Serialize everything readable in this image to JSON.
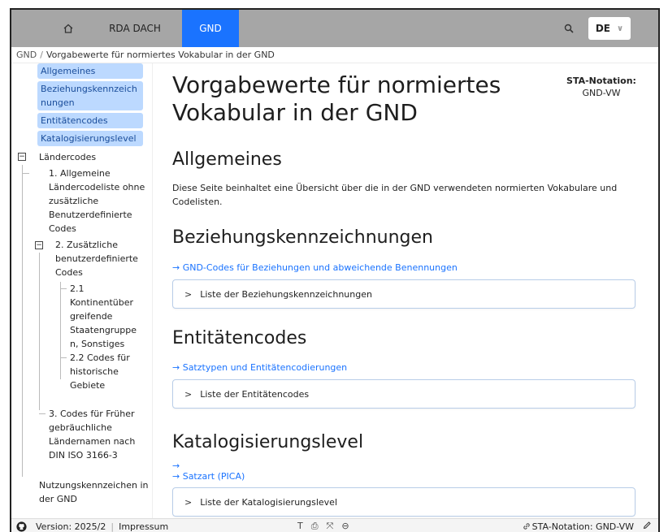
{
  "nav": {
    "home_icon": "home-icon",
    "items": [
      {
        "label": "RDA DACH"
      },
      {
        "label": "GND"
      }
    ],
    "search_icon": "search-icon",
    "language": "DE",
    "accent_color": "#1a73ff"
  },
  "breadcrumb": {
    "root": "GND",
    "separator": "/",
    "current": "Vorgabewerte für normiertes Vokabular in der GND"
  },
  "sidebar": {
    "highlighted": [
      {
        "label": "Allgemeines"
      },
      {
        "label": "Beziehungskennzeich nungen"
      },
      {
        "label": "Entitätencodes"
      },
      {
        "label": "Katalogisierungslevel"
      }
    ],
    "laendercodes": {
      "toggle": "−",
      "label": "Ländercodes",
      "children": [
        {
          "label": "1. Allgemeine Ländercodeliste ohne zusätzliche Benutzerdefinierte Codes"
        },
        {
          "toggle": "−",
          "label": "2. Zusätzliche benutzerdefinierte Codes",
          "children": [
            {
              "label": "2.1 Kontinentüber greifende Staatengruppe n, Sonstiges"
            },
            {
              "label": "2.2 Codes für historische Gebiete"
            }
          ]
        },
        {
          "label": "3. Codes für Früher gebräuchliche Ländernamen nach DIN ISO 3166-3"
        }
      ]
    },
    "nutzung": {
      "label": "Nutzungskennzeichen in der GND"
    }
  },
  "main": {
    "title": "Vorgabewerte für normiertes Vokabular in der GND",
    "sta_label": "STA-Notation:",
    "sta_value": "GND-VW",
    "sections": {
      "allgemeines": {
        "heading": "Allgemeines",
        "text": "Diese Seite beinhaltet eine Übersicht über die in der GND verwendeten normierten Vokabulare und Codelisten."
      },
      "beziehung": {
        "heading": "Beziehungskennzeichnungen",
        "link": "→ GND-Codes für Beziehungen und abweichende Benennungen",
        "details": "Liste der Beziehungskennzeichnungen"
      },
      "entitaet": {
        "heading": "Entitätencodes",
        "link": "→ Satztypen und Entitätencodierungen",
        "details": "Liste der Entitätencodes"
      },
      "katalog": {
        "heading": "Katalogisierungslevel",
        "link_arrow": "→",
        "link": "→ Satzart (PICA)",
        "details": "Liste der Katalogisierungslevel"
      }
    },
    "details_arrow": ">"
  },
  "footer": {
    "version": "Version: 2025/2",
    "impressum": "Impressum",
    "tools": [
      "T",
      "⎙",
      "⤧",
      "⊖"
    ],
    "sta_notation": "STA-Notation: GND-VW"
  }
}
